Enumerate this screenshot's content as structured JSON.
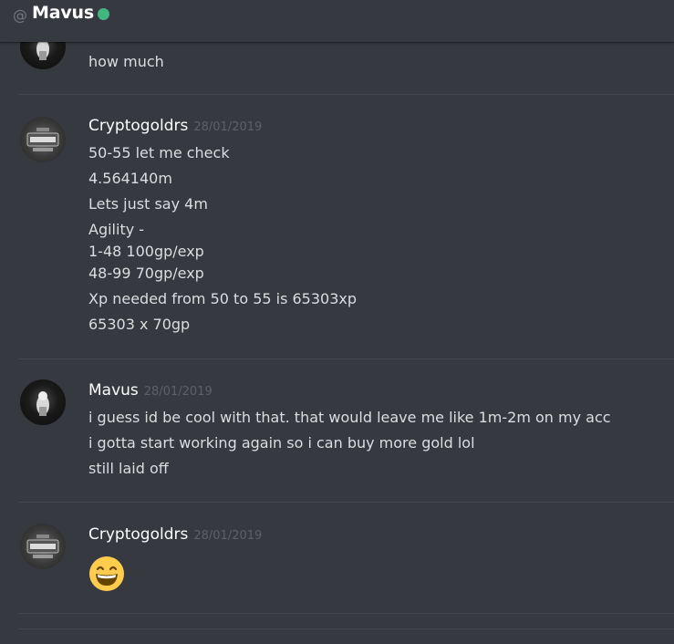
{
  "header": {
    "at_symbol": "@",
    "title": "Mavus",
    "status_color": "#43b581"
  },
  "messages": [
    {
      "author": "",
      "timestamp": "",
      "avatar": "dark-avatar",
      "lines": [
        "how much"
      ]
    },
    {
      "author": "Cryptogoldrs",
      "timestamp": "28/01/2019",
      "avatar": "crypto-gold-avatar",
      "lines": [
        "50-55 let me check",
        "4.564140m",
        "Lets just say 4m",
        "Agility -",
        "1-48 100gp/exp",
        "48-99 70gp/exp",
        "Xp needed from 50 to 55 is 65303xp",
        "65303 x 70gp"
      ]
    },
    {
      "author": "Mavus",
      "timestamp": "28/01/2019",
      "avatar": "dark-avatar",
      "lines": [
        "i guess id be cool with that. that would leave me like 1m-2m on my acc",
        "i gotta start working again so i can buy more gold lol",
        "still laid off"
      ]
    },
    {
      "author": "Cryptogoldrs",
      "timestamp": "28/01/2019",
      "avatar": "crypto-gold-avatar",
      "emoji": "grinning-face-with-smiling-eyes"
    }
  ],
  "colors": {
    "background": "#36393f",
    "text": "#dcddde",
    "username": "#ffffff",
    "timestamp": "#5d6066"
  }
}
